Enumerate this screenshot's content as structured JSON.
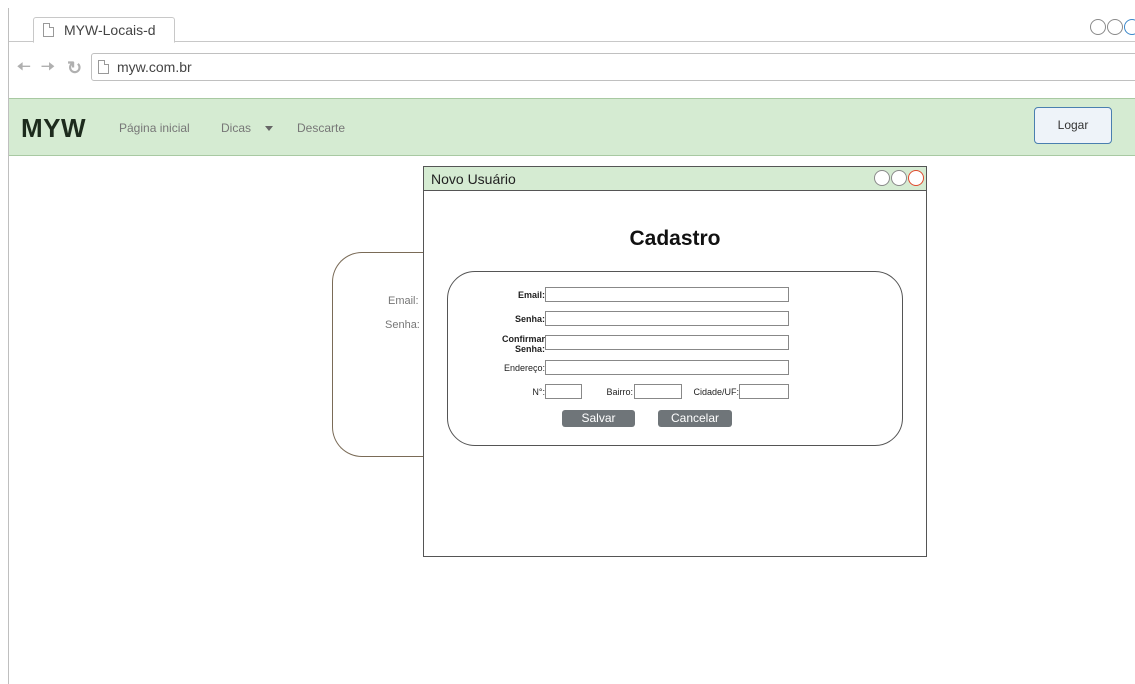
{
  "browser": {
    "tab_title": "MYW-Locais-d",
    "url": "myw.com.br"
  },
  "navbar": {
    "brand": "MYW",
    "links": [
      "Página inicial",
      "Dicas",
      "Descarte"
    ],
    "login_label": "Logar"
  },
  "login_card": {
    "email_label": "Email:",
    "senha_label": "Senha:"
  },
  "dialog": {
    "window_title": "Novo Usuário",
    "heading": "Cadastro",
    "fields": {
      "email": "Email:",
      "senha": "Senha:",
      "confirmar_line1": "Confirmar",
      "confirmar_line2": "Senha:",
      "endereco": "Endereço:",
      "numero": "N°:",
      "bairro": "Bairro:",
      "cidade": "Cidade/UF:"
    },
    "save_label": "Salvar",
    "cancel_label": "Cancelar"
  },
  "colors": {
    "header_green": "#d5ebd2",
    "button_gray": "#6f7579",
    "close_red": "#e04a2e",
    "maximize_blue": "#3b87c9"
  }
}
